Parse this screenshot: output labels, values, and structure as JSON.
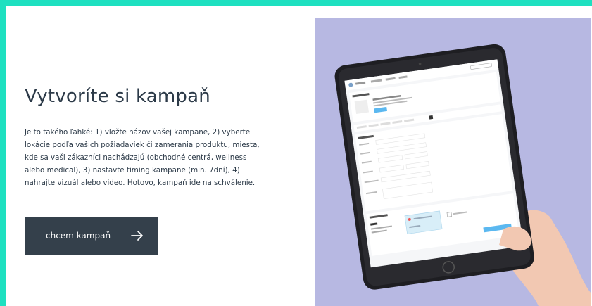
{
  "section": {
    "heading": "Vytvoríte si kampaň",
    "description": "Je to takého ľahké: 1) vložte názov vašej kampane,  2) vyberte lokácie podľa vašich požiadaviek či zamerania produktu, miesta, kde sa vaši zákazníci nachádzajú (obchodné centrá, wellness alebo medical), 3) nastavte timing kampane (min. 7dní), 4) nahrajte vizuál alebo video. Hotovo, kampaň ide na schválenie.",
    "cta_label": "chcem kampaň"
  },
  "icons": {
    "cta_arrow": "arrow-right-icon"
  },
  "colors": {
    "accent_border": "#1ee0c0",
    "button_bg": "#34404b",
    "text": "#2c3a48",
    "photo_bg": "#b7b8e2",
    "tablet_button": "#5bb8f0"
  }
}
